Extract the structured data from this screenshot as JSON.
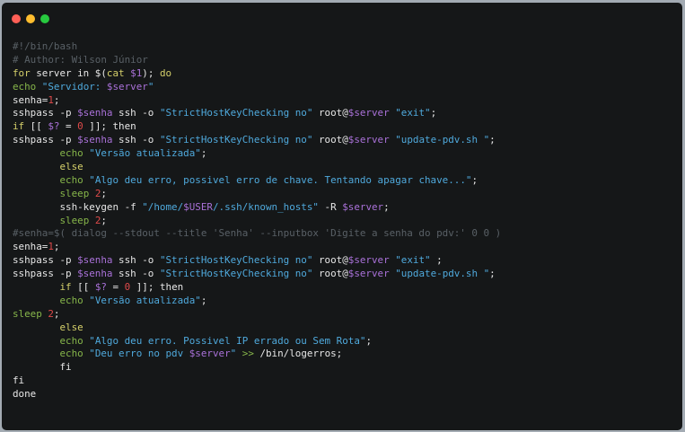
{
  "window": {
    "controls": [
      {
        "name": "close",
        "color": "#ff5f56"
      },
      {
        "name": "minimize",
        "color": "#ffbd2e"
      },
      {
        "name": "maximize",
        "color": "#27c93f"
      }
    ]
  },
  "code": {
    "language": "bash",
    "lines": [
      [
        [
          "c",
          "#!/bin/bash"
        ]
      ],
      [
        [
          "c",
          "# Author: Wilson Júnior"
        ]
      ],
      [
        [
          "k",
          "for"
        ],
        [
          "t",
          " server in $("
        ],
        [
          "k",
          "cat"
        ],
        [
          "t",
          " "
        ],
        [
          "v",
          "$1"
        ],
        [
          "t",
          "); "
        ],
        [
          "k",
          "do"
        ]
      ],
      [
        [
          "g",
          "echo"
        ],
        [
          "t",
          " "
        ],
        [
          "s",
          "\"Servidor: "
        ],
        [
          "v",
          "$server"
        ],
        [
          "s",
          "\""
        ]
      ],
      [
        [
          "t",
          "senha="
        ],
        [
          "n",
          "1"
        ],
        [
          "t",
          ";"
        ]
      ],
      [
        [
          "t",
          "sshpass -p "
        ],
        [
          "v",
          "$senha"
        ],
        [
          "t",
          " ssh -o "
        ],
        [
          "s",
          "\"StrictHostKeyChecking no\""
        ],
        [
          "t",
          " root@"
        ],
        [
          "v",
          "$server"
        ],
        [
          "t",
          " "
        ],
        [
          "s",
          "\"exit\""
        ],
        [
          "t",
          ";"
        ]
      ],
      [
        [
          "k",
          "if"
        ],
        [
          "t",
          " [[ "
        ],
        [
          "v",
          "$?"
        ],
        [
          "t",
          " = "
        ],
        [
          "n",
          "0"
        ],
        [
          "t",
          " ]]; then"
        ]
      ],
      [
        [
          "t",
          "sshpass -p "
        ],
        [
          "v",
          "$senha"
        ],
        [
          "t",
          " ssh -o "
        ],
        [
          "s",
          "\"StrictHostKeyChecking no\""
        ],
        [
          "t",
          " root@"
        ],
        [
          "v",
          "$server"
        ],
        [
          "t",
          " "
        ],
        [
          "s",
          "\"update-pdv.sh \""
        ],
        [
          "t",
          ";"
        ]
      ],
      [
        [
          "t",
          "        "
        ],
        [
          "g",
          "echo"
        ],
        [
          "t",
          " "
        ],
        [
          "s",
          "\"Versão atualizada\""
        ],
        [
          "t",
          ";"
        ]
      ],
      [
        [
          "t",
          "        "
        ],
        [
          "k",
          "else"
        ]
      ],
      [
        [
          "t",
          "        "
        ],
        [
          "g",
          "echo"
        ],
        [
          "t",
          " "
        ],
        [
          "s",
          "\"Algo deu erro, possivel erro de chave. Tentando apagar chave...\""
        ],
        [
          "t",
          ";"
        ]
      ],
      [
        [
          "t",
          "        "
        ],
        [
          "g",
          "sleep"
        ],
        [
          "t",
          " "
        ],
        [
          "n",
          "2"
        ],
        [
          "t",
          ";"
        ]
      ],
      [
        [
          "t",
          "        ssh-keygen -f "
        ],
        [
          "s",
          "\"/home/"
        ],
        [
          "v",
          "$USER"
        ],
        [
          "s",
          "/.ssh/known_hosts\""
        ],
        [
          "t",
          " -R "
        ],
        [
          "v",
          "$server"
        ],
        [
          "t",
          ";"
        ]
      ],
      [
        [
          "t",
          "        "
        ],
        [
          "g",
          "sleep"
        ],
        [
          "t",
          " "
        ],
        [
          "n",
          "2"
        ],
        [
          "t",
          ";"
        ]
      ],
      [
        [
          "c",
          "#senha=$( dialog --stdout --title 'Senha' --inputbox 'Digite a senha do pdv:' 0 0 )"
        ]
      ],
      [
        [
          "t",
          "senha="
        ],
        [
          "n",
          "1"
        ],
        [
          "t",
          ";"
        ]
      ],
      [
        [
          "t",
          "sshpass -p "
        ],
        [
          "v",
          "$senha"
        ],
        [
          "t",
          " ssh -o "
        ],
        [
          "s",
          "\"StrictHostKeyChecking no\""
        ],
        [
          "t",
          " root@"
        ],
        [
          "v",
          "$server"
        ],
        [
          "t",
          " "
        ],
        [
          "s",
          "\"exit\""
        ],
        [
          "t",
          " ;"
        ]
      ],
      [
        [
          "t",
          "sshpass -p "
        ],
        [
          "v",
          "$senha"
        ],
        [
          "t",
          " ssh -o "
        ],
        [
          "s",
          "\"StrictHostKeyChecking no\""
        ],
        [
          "t",
          " root@"
        ],
        [
          "v",
          "$server"
        ],
        [
          "t",
          " "
        ],
        [
          "s",
          "\"update-pdv.sh \""
        ],
        [
          "t",
          ";"
        ]
      ],
      [
        [
          "t",
          "        "
        ],
        [
          "k",
          "if"
        ],
        [
          "t",
          " [[ "
        ],
        [
          "v",
          "$?"
        ],
        [
          "t",
          " = "
        ],
        [
          "n",
          "0"
        ],
        [
          "t",
          " ]]; then"
        ]
      ],
      [
        [
          "t",
          "        "
        ],
        [
          "g",
          "echo"
        ],
        [
          "t",
          " "
        ],
        [
          "s",
          "\"Versão atualizada\""
        ],
        [
          "t",
          ";"
        ]
      ],
      [
        [
          "g",
          "sleep"
        ],
        [
          "t",
          " "
        ],
        [
          "n",
          "2"
        ],
        [
          "t",
          ";"
        ]
      ],
      [
        [
          "t",
          "        "
        ],
        [
          "k",
          "else"
        ]
      ],
      [
        [
          "t",
          "        "
        ],
        [
          "g",
          "echo"
        ],
        [
          "t",
          " "
        ],
        [
          "s",
          "\"Algo deu erro. Possivel IP errado ou Sem Rota\""
        ],
        [
          "t",
          ";"
        ]
      ],
      [
        [
          "t",
          "        "
        ],
        [
          "g",
          "echo"
        ],
        [
          "t",
          " "
        ],
        [
          "s",
          "\"Deu erro no pdv "
        ],
        [
          "v",
          "$server"
        ],
        [
          "s",
          "\""
        ],
        [
          "t",
          " "
        ],
        [
          "g",
          ">>"
        ],
        [
          "t",
          " /bin/logerros;"
        ]
      ],
      [
        [
          "t",
          "        fi"
        ]
      ],
      [
        [
          "t",
          "fi"
        ]
      ],
      [
        [
          "t",
          "done"
        ]
      ]
    ]
  }
}
